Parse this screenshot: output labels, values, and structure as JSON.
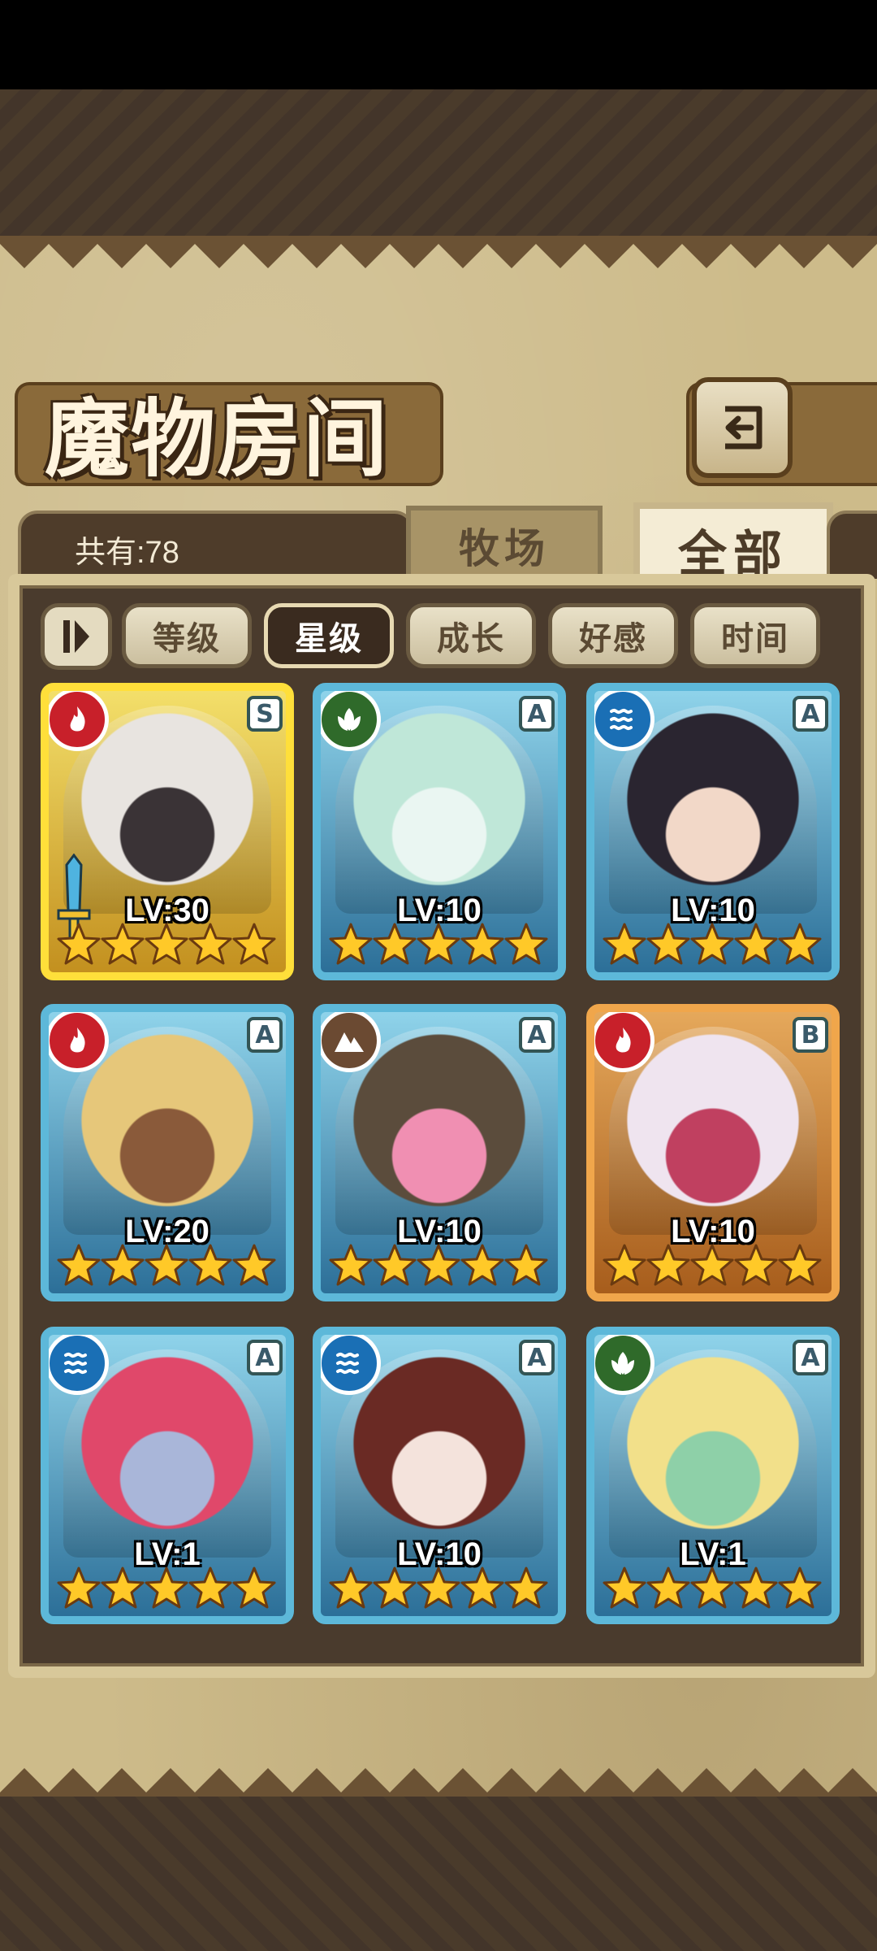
{
  "header": {
    "title": "魔物房间",
    "back_icon": "back-arrow-icon"
  },
  "tabs": {
    "count_label": "共有:78",
    "ranch": "牧场",
    "all": "全部",
    "active": "all"
  },
  "filters": {
    "sort_toggle_icon": "sort-order-icon",
    "items": [
      "等级",
      "星级",
      "成长",
      "好感",
      "时间"
    ],
    "active": "星级"
  },
  "monsters": [
    {
      "level": "LV:30",
      "grade": "S",
      "element": "fire",
      "frame": "gold",
      "stars": 5,
      "equipped_icon": "sword-icon"
    },
    {
      "level": "LV:10",
      "grade": "A",
      "element": "wood",
      "frame": "blue",
      "stars": 5
    },
    {
      "level": "LV:10",
      "grade": "A",
      "element": "water",
      "frame": "blue",
      "stars": 5
    },
    {
      "level": "LV:20",
      "grade": "A",
      "element": "fire",
      "frame": "blue",
      "stars": 5
    },
    {
      "level": "LV:10",
      "grade": "A",
      "element": "earth",
      "frame": "blue",
      "stars": 5
    },
    {
      "level": "LV:10",
      "grade": "B",
      "element": "fire",
      "frame": "bronze",
      "stars": 5
    },
    {
      "level": "LV:1",
      "grade": "A",
      "element": "water",
      "frame": "blue",
      "stars": 5
    },
    {
      "level": "LV:10",
      "grade": "A",
      "element": "water",
      "frame": "blue",
      "stars": 5
    },
    {
      "level": "LV:1",
      "grade": "A",
      "element": "wood",
      "frame": "blue",
      "stars": 5
    }
  ],
  "colors": {
    "fire": "#c8202a",
    "wood": "#2f6a2a",
    "water": "#1a6fb5",
    "earth": "#6b4a32",
    "star": "#ffc928"
  }
}
